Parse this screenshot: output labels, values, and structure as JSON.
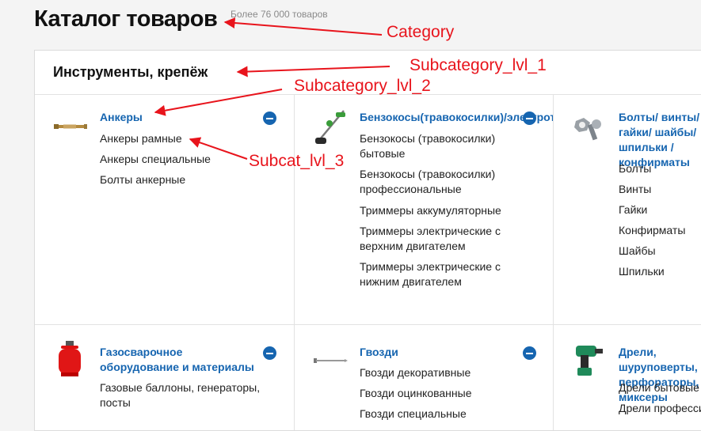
{
  "header": {
    "title": "Каталог товаров",
    "count": "Более 76 000 товаров"
  },
  "section": {
    "title": "Инструменты, крепёж"
  },
  "categories": [
    {
      "title": "Анкеры",
      "items": [
        "Анкеры рамные",
        "Анкеры специальные",
        "Болты анкерные"
      ]
    },
    {
      "title": "Бензокосы(травокосилки)/электротриммеры",
      "items": [
        "Бензокосы (травокосилки) бытовые",
        "Бензокосы (травокосилки) профессиональные",
        "Триммеры аккумуляторные",
        "Триммеры электрические с верхним двигателем",
        "Триммеры электрические с нижним двигателем"
      ]
    },
    {
      "title": "Болты/ винты/ гайки/ шайбы/шпильки /конфирматы",
      "items": [
        "Болты",
        "Винты",
        "Гайки",
        "Конфирматы",
        "Шайбы",
        "Шпильки"
      ]
    },
    {
      "title": "Газосварочное оборудование и материалы",
      "items": [
        "Газовые баллоны, генераторы, посты"
      ]
    },
    {
      "title": "Гвозди",
      "items": [
        "Гвозди декоративные",
        "Гвозди оцинкованные",
        "Гвозди специальные"
      ]
    },
    {
      "title": "Дрели, шуруповерты, перфораторы, миксеры",
      "items": [
        "Дрели бытовые",
        "Дрели профессиональные"
      ]
    }
  ],
  "annotations": {
    "category": "Category",
    "subcategory_lvl_1": "Subcategory_lvl_1",
    "subcategory_lvl_2": "Subcategory_lvl_2",
    "subcat_lvl_3": "Subcat_lvl_3"
  },
  "colors": {
    "link": "#1665b0",
    "annotation": "#e8141c",
    "border": "#e2e2e2"
  },
  "icons": [
    "anchor-bolt-icon",
    "grass-trimmer-icon",
    "bolts-nuts-icon",
    "gas-cylinder-icon",
    "nail-icon",
    "drill-icon",
    "collapse-minus-icon"
  ]
}
